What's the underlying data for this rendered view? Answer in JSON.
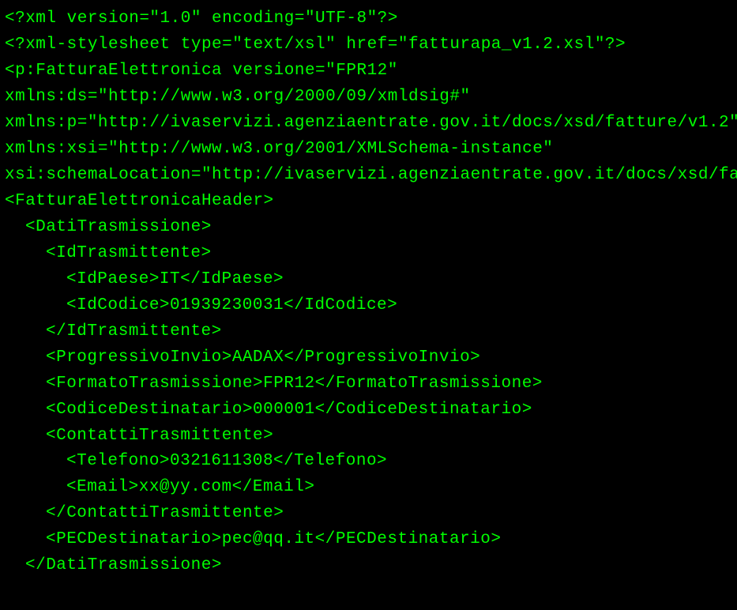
{
  "lines": {
    "l1": "<?xml version=\"1.0\" encoding=\"UTF-8\"?>",
    "l2": "<?xml-stylesheet type=\"text/xsl\" href=\"fatturapa_v1.2.xsl\"?>",
    "l3": "<p:FatturaElettronica versione=\"FPR12\"",
    "l4": "xmlns:ds=\"http://www.w3.org/2000/09/xmldsig#\"",
    "l5": "xmlns:p=\"http://ivaservizi.agenziaentrate.gov.it/docs/xsd/fatture/v1.2\"",
    "l6": "xmlns:xsi=\"http://www.w3.org/2001/XMLSchema-instance\"",
    "l7": "xsi:schemaLocation=\"http://ivaservizi.agenziaentrate.gov.it/docs/xsd/fa",
    "l8": "<FatturaElettronicaHeader>",
    "l9": "<DatiTrasmissione>",
    "l10": "<IdTrasmittente>",
    "l11": "<IdPaese>IT</IdPaese>",
    "l12": "<IdCodice>01939230031</IdCodice>",
    "l13": "</IdTrasmittente>",
    "l14": "<ProgressivoInvio>AADAX</ProgressivoInvio>",
    "l15": "<FormatoTrasmissione>FPR12</FormatoTrasmissione>",
    "l16": "<CodiceDestinatario>000001</CodiceDestinatario>",
    "l17": "<ContattiTrasmittente>",
    "l18": "<Telefono>0321611308</Telefono>",
    "l19": "<Email>xx@yy.com</Email>",
    "l20": "</ContattiTrasmittente>",
    "l21": "<PECDestinatario>pec@qq.it</PECDestinatario>",
    "l22": "</DatiTrasmissione>"
  }
}
